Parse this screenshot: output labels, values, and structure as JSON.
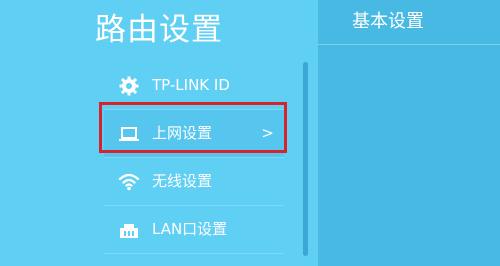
{
  "sidebar": {
    "title": "路由设置",
    "items": [
      {
        "label": "TP-LINK ID",
        "icon": "gear-icon"
      },
      {
        "label": "上网设置",
        "icon": "laptop-icon",
        "chevron": ">",
        "selected": true
      },
      {
        "label": "无线设置",
        "icon": "wifi-icon"
      },
      {
        "label": "LAN口设置",
        "icon": "lan-port-icon"
      }
    ]
  },
  "main": {
    "title": "基本设置"
  },
  "colors": {
    "sidebar_bg": "#5fcff3",
    "main_bg": "#47b9e3",
    "highlight_box": "#d7232b",
    "text": "#ffffff"
  }
}
